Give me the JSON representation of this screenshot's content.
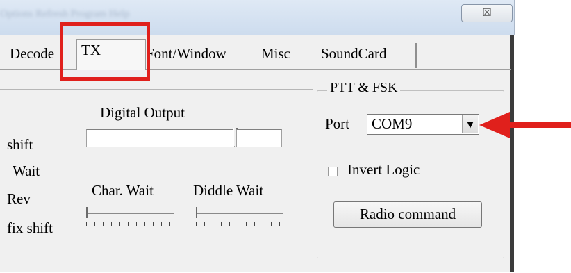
{
  "window": {
    "menu_blurred": "Options  Refresh  Program  Help",
    "close_glyph": "☒"
  },
  "tabs": [
    {
      "label": "Decode",
      "active": false
    },
    {
      "label": "TX",
      "active": true
    },
    {
      "label": "Font/Window",
      "active": false
    },
    {
      "label": "Misc",
      "active": false
    },
    {
      "label": "SoundCard",
      "active": false
    }
  ],
  "left_labels": [
    "shift",
    "Wait",
    "Rev",
    "fix shift"
  ],
  "digital_output": {
    "label": "Digital Output"
  },
  "char_wait": {
    "label": "Char. Wait"
  },
  "diddle_wait": {
    "label": "Diddle Wait"
  },
  "ptt_fsk": {
    "title": "PTT & FSK",
    "port_label": "Port",
    "port_value": "COM9",
    "invert_logic_label": "Invert Logic",
    "invert_logic_checked": false,
    "radio_command_label": "Radio command"
  },
  "colors": {
    "annotation": "#e0201c"
  }
}
